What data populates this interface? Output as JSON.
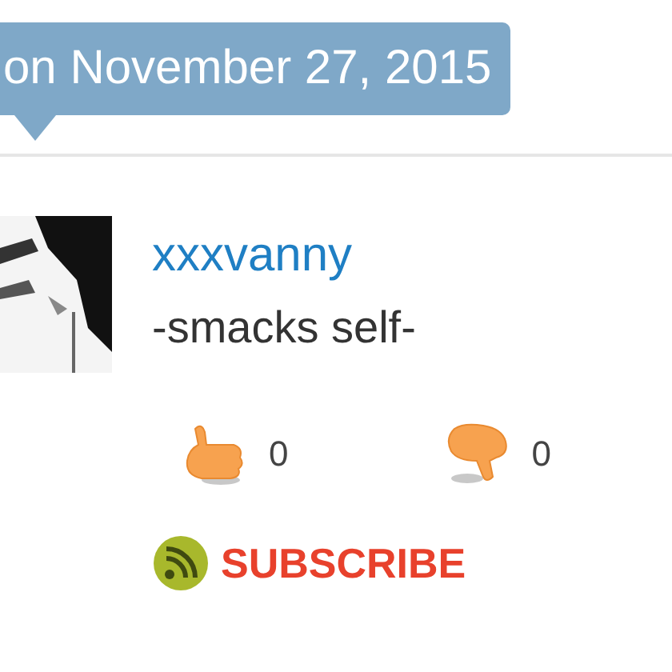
{
  "tooltip": {
    "text": "on November 27, 2015"
  },
  "comment": {
    "username": "xxxvanny",
    "text": "-smacks self-",
    "votes": [
      {
        "kind": "up",
        "count": "0"
      },
      {
        "kind": "down",
        "count": "0"
      }
    ]
  },
  "subscribe": {
    "label": "SUBSCRIBE"
  }
}
